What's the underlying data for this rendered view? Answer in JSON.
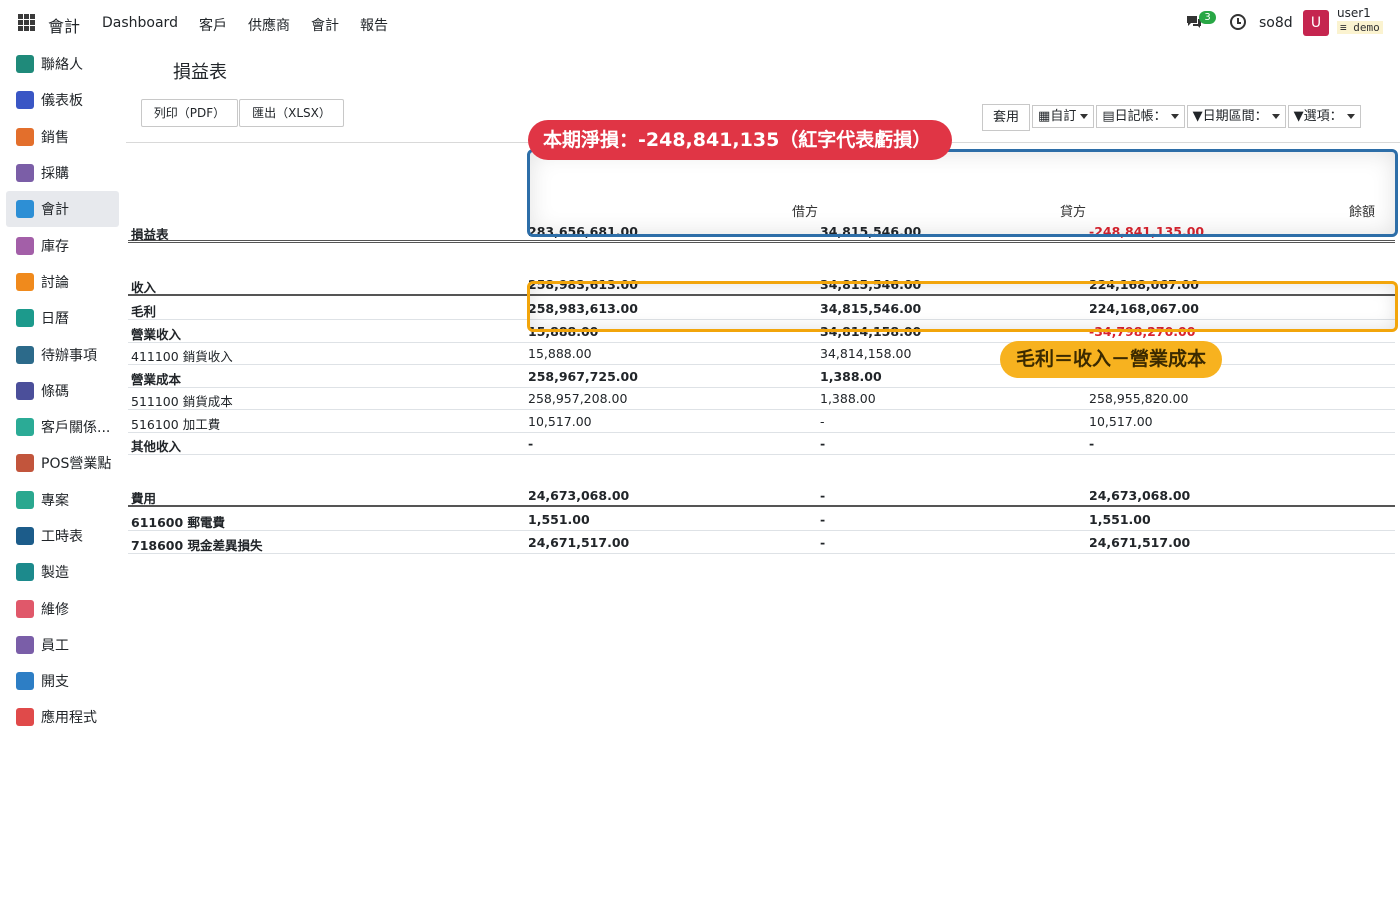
{
  "app": {
    "title": "會計"
  },
  "topnav": [
    "Dashboard",
    "客戶",
    "供應商",
    "會計",
    "報告"
  ],
  "systray": {
    "chat_count": "3",
    "db": "so8d",
    "avatar_letter": "U",
    "user": "user1",
    "user_db": "demo"
  },
  "sidebar": {
    "items": [
      {
        "label": "聯絡人",
        "color": "#1f8a7a"
      },
      {
        "label": "儀表板",
        "color": "#3a56c5"
      },
      {
        "label": "銷售",
        "color": "#e36f2c"
      },
      {
        "label": "採購",
        "color": "#7b5ea7"
      },
      {
        "label": "會計",
        "color": "#2d8fd5",
        "active": true
      },
      {
        "label": "庫存",
        "color": "#a35fa8"
      },
      {
        "label": "討論",
        "color": "#f08a1c"
      },
      {
        "label": "日曆",
        "color": "#1c9a8c"
      },
      {
        "label": "待辦事項",
        "color": "#2c6a8a"
      },
      {
        "label": "條碼",
        "color": "#4b4f9a"
      },
      {
        "label": "客戶關係...",
        "color": "#2bab96"
      },
      {
        "label": "POS營業點",
        "color": "#c2553c"
      },
      {
        "label": "專案",
        "color": "#2aa88f"
      },
      {
        "label": "工時表",
        "color": "#1c5c8a"
      },
      {
        "label": "製造",
        "color": "#1c8a8c"
      },
      {
        "label": "維修",
        "color": "#e0586a"
      },
      {
        "label": "員工",
        "color": "#7a5ea8"
      },
      {
        "label": "開支",
        "color": "#2d7ec5"
      },
      {
        "label": "應用程式",
        "color": "#e04a4a"
      }
    ]
  },
  "page": {
    "title": "損益表"
  },
  "buttons": {
    "print": "列印（PDF）",
    "export": "匯出（XLSX）"
  },
  "filters": {
    "apply": "套用",
    "custom": "自訂",
    "journal": "日記帳：",
    "date_range": "日期區間：",
    "options": "選項："
  },
  "columns": {
    "debit": "借方",
    "credit": "貸方",
    "balance": "餘額"
  },
  "rows": [
    {
      "label": "損益表",
      "debit": "283,656,681.00",
      "credit": "34,815,546.00",
      "balance": "-248,841,135.00"
    },
    {
      "label": "收入",
      "debit": "258,983,613.00",
      "credit": "34,815,546.00",
      "balance": "224,168,067.00"
    },
    {
      "label": "毛利",
      "debit": "258,983,613.00",
      "credit": "34,815,546.00",
      "balance": "224,168,067.00"
    },
    {
      "label": "營業收入",
      "debit": "15,888.00",
      "credit": "34,814,158.00",
      "balance": "-34,798,270.00"
    },
    {
      "label": "411100 銷貨收入",
      "debit": "15,888.00",
      "credit": "34,814,158.00",
      "balance": ""
    },
    {
      "label": "營業成本",
      "debit": "258,967,725.00",
      "credit": "1,388.00",
      "balance": ""
    },
    {
      "label": "511100 銷貨成本",
      "debit": "258,957,208.00",
      "credit": "1,388.00",
      "balance": "258,955,820.00"
    },
    {
      "label": "516100 加工費",
      "debit": "10,517.00",
      "credit": "-",
      "balance": "10,517.00"
    },
    {
      "label": "其他收入",
      "debit": "-",
      "credit": "-",
      "balance": "-"
    },
    {
      "label": "費用",
      "debit": "24,673,068.00",
      "credit": "-",
      "balance": "24,673,068.00"
    },
    {
      "label": "611600 郵電費",
      "debit": "1,551.00",
      "credit": "-",
      "balance": "1,551.00"
    },
    {
      "label": "718600 現金差異損失",
      "debit": "24,671,517.00",
      "credit": "-",
      "balance": "24,671,517.00"
    }
  ],
  "annotations": {
    "net_loss": "本期淨損：-248,841,135（紅字代表虧損）",
    "gross_profit": "毛利＝收入－營業成本"
  }
}
